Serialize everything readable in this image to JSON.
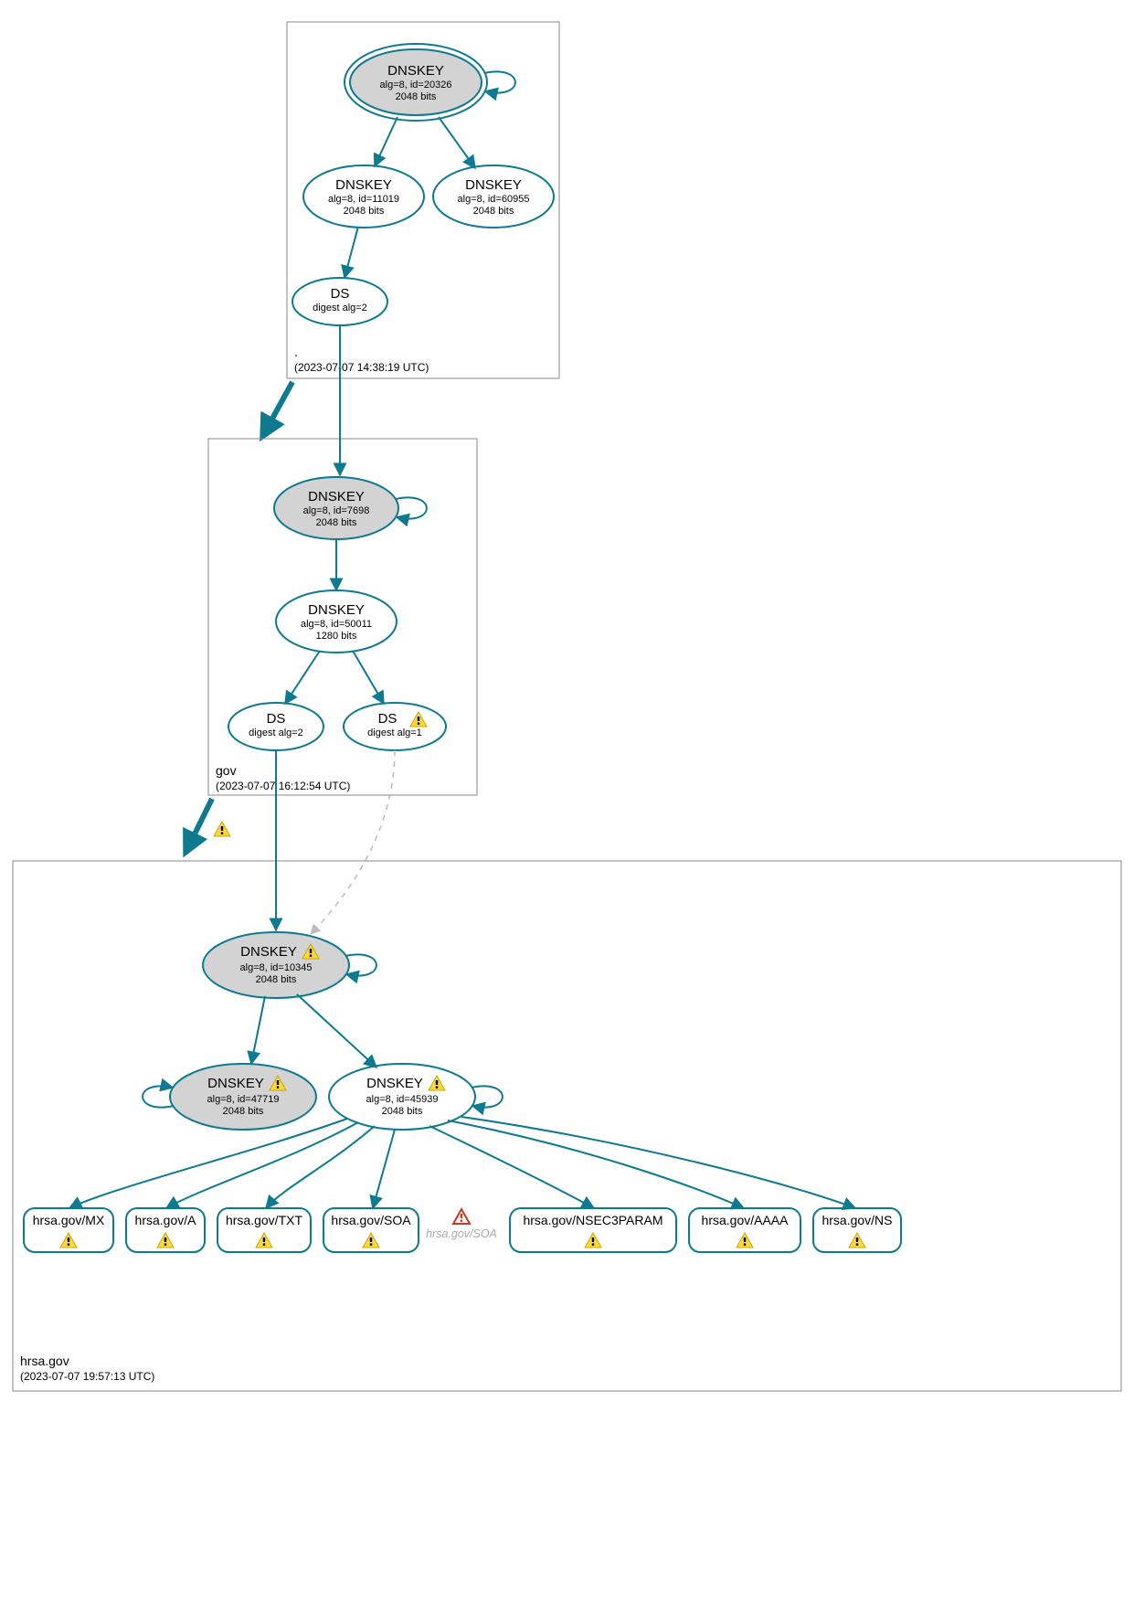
{
  "zones": {
    "root": {
      "title": ".",
      "time": "(2023-07-07 14:38:19 UTC)"
    },
    "gov": {
      "title": "gov",
      "time": "(2023-07-07 16:12:54 UTC)"
    },
    "hrsa": {
      "title": "hrsa.gov",
      "time": "(2023-07-07 19:57:13 UTC)"
    }
  },
  "nodes": {
    "root_ksk": {
      "title": "DNSKEY",
      "sub1": "alg=8, id=20326",
      "sub2": "2048 bits"
    },
    "root_zsk1": {
      "title": "DNSKEY",
      "sub1": "alg=8, id=11019",
      "sub2": "2048 bits"
    },
    "root_zsk2": {
      "title": "DNSKEY",
      "sub1": "alg=8, id=60955",
      "sub2": "2048 bits"
    },
    "root_ds": {
      "title": "DS",
      "sub1": "digest alg=2"
    },
    "gov_ksk": {
      "title": "DNSKEY",
      "sub1": "alg=8, id=7698",
      "sub2": "2048 bits"
    },
    "gov_zsk": {
      "title": "DNSKEY",
      "sub1": "alg=8, id=50011",
      "sub2": "1280 bits"
    },
    "gov_ds1": {
      "title": "DS",
      "sub1": "digest alg=2"
    },
    "gov_ds2": {
      "title": "DS",
      "sub1": "digest alg=1"
    },
    "hrsa_ksk": {
      "title": "DNSKEY",
      "sub1": "alg=8, id=10345",
      "sub2": "2048 bits"
    },
    "hrsa_zsk1": {
      "title": "DNSKEY",
      "sub1": "alg=8, id=47719",
      "sub2": "2048 bits"
    },
    "hrsa_zsk2": {
      "title": "DNSKEY",
      "sub1": "alg=8, id=45939",
      "sub2": "2048 bits"
    }
  },
  "rrsets": {
    "mx": "hrsa.gov/MX",
    "a": "hrsa.gov/A",
    "txt": "hrsa.gov/TXT",
    "soa": "hrsa.gov/SOA",
    "soa2": "hrsa.gov/SOA",
    "nsec": "hrsa.gov/NSEC3PARAM",
    "aaaa": "hrsa.gov/AAAA",
    "ns": "hrsa.gov/NS"
  }
}
